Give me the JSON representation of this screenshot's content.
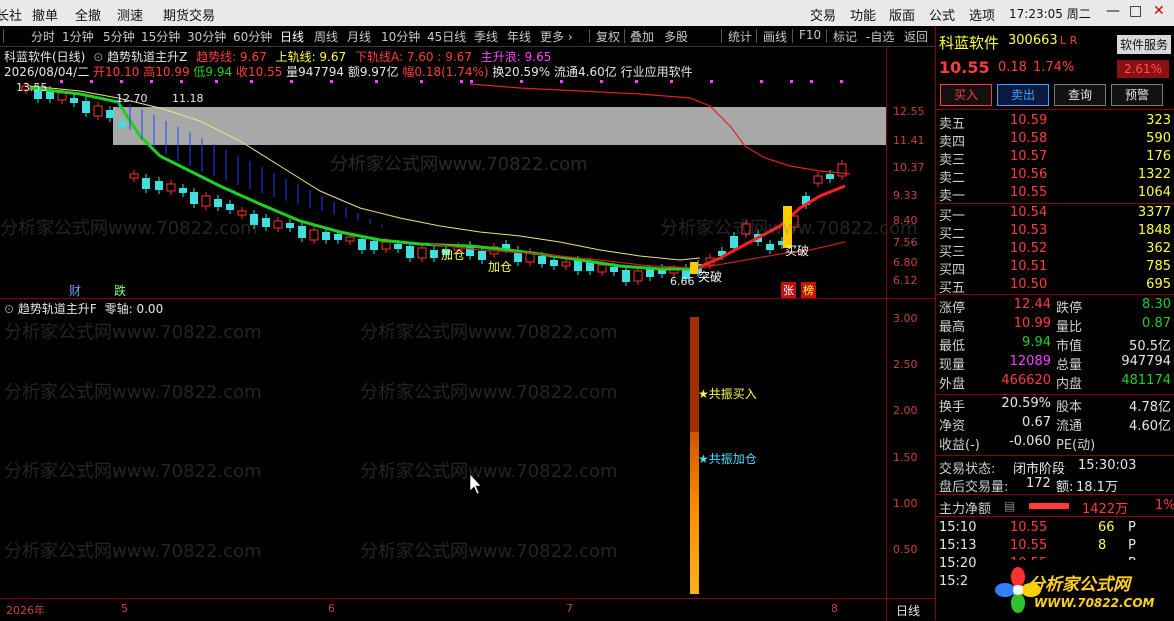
{
  "menubar": {
    "items": [
      "长社",
      "撤单",
      "全撤",
      "测速",
      "期货交易"
    ],
    "right_items": [
      "交易",
      "功能",
      "版面",
      "公式",
      "选项"
    ],
    "clock": "17:23:05 周二",
    "win_min": "—",
    "win_max": "□",
    "win_close": "✕"
  },
  "timeframes": [
    "分时",
    "1分钟",
    "5分钟",
    "15分钟",
    "30分钟",
    "60分钟",
    "日线",
    "周线",
    "月线",
    "10分钟",
    "45日线",
    "季线",
    "年线",
    "更多 ›"
  ],
  "timeframe_active": "日线",
  "toolbar": [
    "复权",
    "叠加",
    "多股",
    "统计",
    "画线",
    "F10",
    "标记",
    "-自选",
    "返回"
  ],
  "main": {
    "title_name": "科蓝软件(日线)",
    "indicator_name": "趋势轨道主升Z",
    "ind_vals": [
      {
        "label": "趋势线: 9.67",
        "color": "#ff3c3c"
      },
      {
        "label": "上轨线: 9.67",
        "color": "#ffff40"
      },
      {
        "label": "下轨线A: 7.60",
        "color": "#ff3c3c"
      },
      {
        "label": ": 9.67",
        "color": "#ff3c3c"
      },
      {
        "label": "主升浪: 9.65",
        "color": "#ff40ff"
      }
    ],
    "info_date": "2026/08/04/二",
    "info_items": [
      {
        "label": "开10.10",
        "color": "#ff3c3c"
      },
      {
        "label": "高10.99",
        "color": "#ff3c3c"
      },
      {
        "label": "低9.94",
        "color": "#20d020"
      },
      {
        "label": "收10.55",
        "color": "#ff3c3c"
      },
      {
        "label": "量947794",
        "color": "#e6e6e6"
      },
      {
        "label": "额9.97亿",
        "color": "#e6e6e6"
      },
      {
        "label": "幅0.18(1.74%)",
        "color": "#ff3c3c"
      },
      {
        "label": "换20.59%",
        "color": "#e6e6e6"
      },
      {
        "label": "流通4.60亿",
        "color": "#e6e6e6"
      },
      {
        "label": "行业应用软件",
        "color": "#e6e6e6"
      }
    ],
    "high_label": "12.70",
    "high_label2": "11.18",
    "left_label": "13.55",
    "low_label": "6.66",
    "y_ticks": [
      "12.55",
      "11.41",
      "10.37",
      "9.33",
      "8.40",
      "7.56",
      "6.80",
      "6.12"
    ],
    "annotations": {
      "cai": "财",
      "die": "跌",
      "jiacang1": "加仓",
      "jiacang2": "加仓",
      "tupo": "突破",
      "maipo": "买破",
      "zhang": "张",
      "bang": "榜"
    }
  },
  "sub": {
    "indicator_name": "趋势轨道主升F",
    "zero_axis": "零轴: 0.00",
    "y_ticks": [
      "3.00",
      "2.50",
      "2.00",
      "1.50",
      "1.00",
      "0.50"
    ],
    "signal_buy": "★共振买入",
    "signal_add": "★共振加仓"
  },
  "xaxis": {
    "labels": [
      "2026年",
      "5",
      "6",
      "7",
      "8"
    ],
    "period": "日线"
  },
  "watermark": "分析家公式网www.70822.com",
  "panel": {
    "name": "科蓝软件",
    "code": "300663",
    "flags": "L R",
    "tag": "软件服务",
    "price": "10.55",
    "change": "0.18",
    "change_pct": "1.74%",
    "tag_pct": "2.61%",
    "buttons": [
      "买入",
      "卖出",
      "查询",
      "预警"
    ],
    "asks": [
      {
        "label": "卖五",
        "price": "10.59",
        "vol": "323"
      },
      {
        "label": "卖四",
        "price": "10.58",
        "vol": "590"
      },
      {
        "label": "卖三",
        "price": "10.57",
        "vol": "176"
      },
      {
        "label": "卖二",
        "price": "10.56",
        "vol": "1322"
      },
      {
        "label": "卖一",
        "price": "10.55",
        "vol": "1064"
      }
    ],
    "bids": [
      {
        "label": "买一",
        "price": "10.54",
        "vol": "3377"
      },
      {
        "label": "买二",
        "price": "10.53",
        "vol": "1848"
      },
      {
        "label": "买三",
        "price": "10.52",
        "vol": "362"
      },
      {
        "label": "买四",
        "price": "10.51",
        "vol": "785"
      },
      {
        "label": "买五",
        "price": "10.50",
        "vol": "695"
      }
    ],
    "stats": [
      {
        "l1": "涨停",
        "v1": "12.44",
        "c1": "#ff3c3c",
        "l2": "跌停",
        "v2": "8.30",
        "c2": "#20d020"
      },
      {
        "l1": "最高",
        "v1": "10.99",
        "c1": "#ff3c3c",
        "l2": "量比",
        "v2": "0.87",
        "c2": "#20d020"
      },
      {
        "l1": "最低",
        "v1": "9.94",
        "c1": "#20d020",
        "l2": "市值",
        "v2": "50.5亿",
        "c2": "#e6e6e6"
      },
      {
        "l1": "现量",
        "v1": "12089",
        "c1": "#ff40ff",
        "l2": "总量",
        "v2": "947794",
        "c2": "#e6e6e6"
      },
      {
        "l1": "外盘",
        "v1": "466620",
        "c1": "#ff3c3c",
        "l2": "内盘",
        "v2": "481174",
        "c2": "#20d020"
      }
    ],
    "stats2": [
      {
        "l1": "换手",
        "v1": "20.59%",
        "c1": "#e6e6e6",
        "l2": "股本",
        "v2": "4.78亿",
        "c2": "#e6e6e6"
      },
      {
        "l1": "净资",
        "v1": "0.67",
        "c1": "#e6e6e6",
        "l2": "流通",
        "v2": "4.60亿",
        "c2": "#e6e6e6"
      },
      {
        "l1": "收益(-)",
        "v1": "-0.060",
        "c1": "#e6e6e6",
        "l2": "PE(动)",
        "v2": "",
        "c2": "#e6e6e6"
      }
    ],
    "trade_status_label": "交易状态:",
    "trade_status": "闭市阶段",
    "trade_time": "15:30:03",
    "after_label": "盘后交易量:",
    "after_vol": "172",
    "after_amt_label": "额:",
    "after_amt": "18.1万",
    "net_label": "主力净额",
    "net_val": "1422万",
    "net_pct": "1%",
    "ticks": [
      {
        "t": "15:10",
        "p": "10.55",
        "v": "66",
        "f": "P"
      },
      {
        "t": "15:13",
        "p": "10.55",
        "v": "8",
        "f": "P"
      },
      {
        "t": "15:20",
        "p": "10.55",
        "v": "",
        "f": "P"
      },
      {
        "t": "15:2",
        "p": "",
        "v": "",
        "f": ""
      }
    ],
    "logo_text": "分析家公式网",
    "logo_url": "WWW.70822.COM"
  }
}
